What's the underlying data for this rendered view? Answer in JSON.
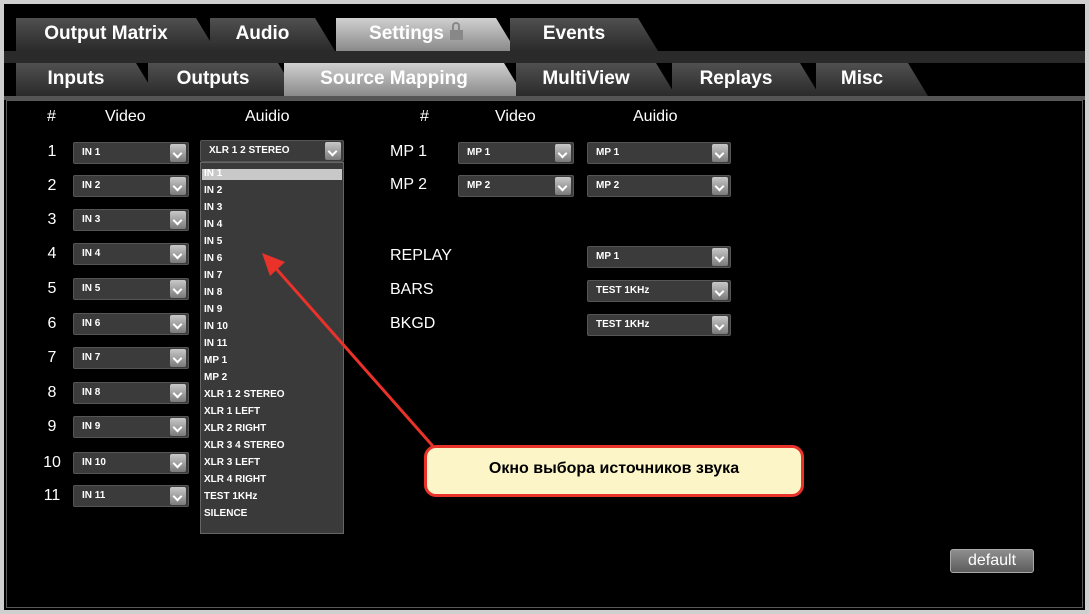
{
  "tabs_main": [
    {
      "label": "Output Matrix"
    },
    {
      "label": "Audio"
    },
    {
      "label": "Settings"
    },
    {
      "label": "Events"
    }
  ],
  "tabs_sub": [
    {
      "label": "Inputs"
    },
    {
      "label": "Outputs"
    },
    {
      "label": "Source Mapping"
    },
    {
      "label": "MultiView"
    },
    {
      "label": "Replays"
    },
    {
      "label": "Misc"
    }
  ],
  "headers": {
    "left_num": "#",
    "left_video": "Video",
    "left_audio": "Auidio",
    "right_num": "#",
    "right_video": "Video",
    "right_audio": "Auidio"
  },
  "input_rows": [
    {
      "num": "1",
      "video": "IN 1",
      "audio": "XLR 1 2 STEREO"
    },
    {
      "num": "2",
      "video": "IN 2"
    },
    {
      "num": "3",
      "video": "IN 3"
    },
    {
      "num": "4",
      "video": "IN 4"
    },
    {
      "num": "5",
      "video": "IN 5"
    },
    {
      "num": "6",
      "video": "IN 6"
    },
    {
      "num": "7",
      "video": "IN 7"
    },
    {
      "num": "8",
      "video": "IN 8"
    },
    {
      "num": "9",
      "video": "IN 9"
    },
    {
      "num": "10",
      "video": "IN 10"
    },
    {
      "num": "11",
      "video": "IN 11"
    }
  ],
  "mp_rows": [
    {
      "label": "MP 1",
      "video": "MP 1",
      "audio": "MP 1"
    },
    {
      "label": "MP 2",
      "video": "MP 2",
      "audio": "MP 2"
    }
  ],
  "special_rows": [
    {
      "label": "REPLAY",
      "audio": "MP 1"
    },
    {
      "label": "BARS",
      "audio": "TEST 1KHz"
    },
    {
      "label": "BKGD",
      "audio": "TEST 1KHz"
    }
  ],
  "audio_dropdown": {
    "selected": "IN 1",
    "options": [
      "IN 1",
      "IN 2",
      "IN 3",
      "IN 4",
      "IN 5",
      "IN 6",
      "IN 7",
      "IN 8",
      "IN 9",
      "IN 10",
      "IN 11",
      "MP 1",
      "MP 2",
      "XLR 1 2 STEREO",
      "XLR 1 LEFT",
      "XLR 2 RIGHT",
      "XLR 3 4 STEREO",
      "XLR 3 LEFT",
      "XLR 4 RIGHT",
      "TEST 1KHz",
      "SILENCE"
    ]
  },
  "callout_text": "Окно выбора источников звука",
  "default_button": "default",
  "colors": {
    "background": "#000000",
    "callout_fill": "#fbf5c8",
    "callout_border": "#e8322a",
    "arrow": "#e8322a"
  }
}
